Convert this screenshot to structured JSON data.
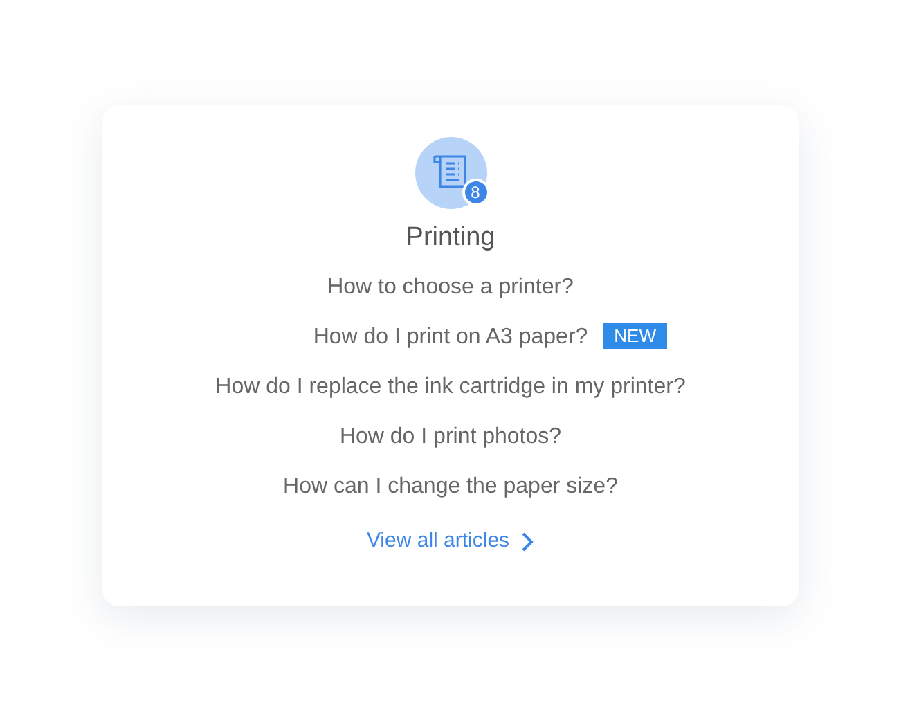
{
  "category": {
    "title": "Printing",
    "count": "8"
  },
  "articles": [
    {
      "title": "How to choose a printer?"
    },
    {
      "title": "How do I print on A3 paper?",
      "badge": "NEW"
    },
    {
      "title": "How do I replace the ink cartridge in my printer?"
    },
    {
      "title": "How do I print photos?"
    },
    {
      "title": "How can I change the paper size?"
    }
  ],
  "link": {
    "label": "View all articles"
  }
}
